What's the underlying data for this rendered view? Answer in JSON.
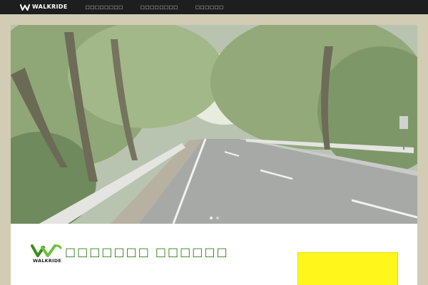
{
  "header": {
    "logo_text": "WALKRIDE",
    "nav": [
      {
        "label": "□□□□□□□□"
      },
      {
        "label": "□□□□□□□□"
      },
      {
        "label": "□□□□□□"
      }
    ]
  },
  "hero": {
    "slides": 2,
    "active_slide": 0
  },
  "content": {
    "brand_text": "WALKRIDE",
    "site_title": "□□□□□□□ □□□□□□"
  },
  "colors": {
    "topbar": "#1e1e1e",
    "page_bg": "#d1ccb3",
    "brand_green": "#2e7d12",
    "promo_yellow": "#fff71c"
  }
}
